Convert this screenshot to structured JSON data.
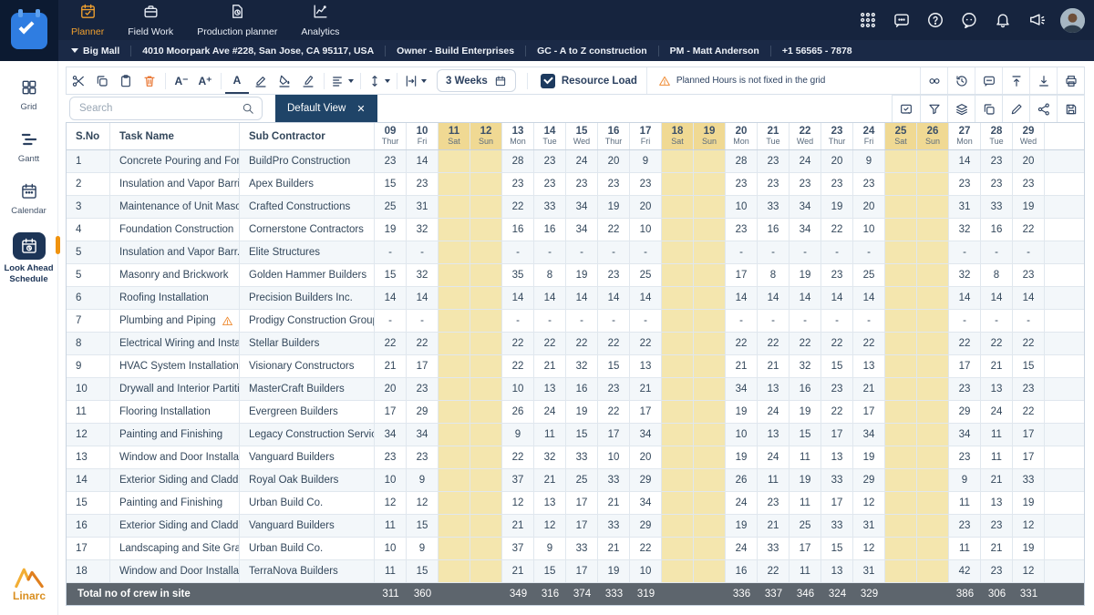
{
  "brand": {
    "name": "Linarc"
  },
  "topnav": {
    "tabs": [
      {
        "label": "Planner",
        "icon": "planner",
        "active": true
      },
      {
        "label": "Field Work",
        "icon": "fieldwork",
        "active": false
      },
      {
        "label": "Production planner",
        "icon": "production",
        "active": false
      },
      {
        "label": "Analytics",
        "icon": "analytics",
        "active": false
      }
    ],
    "right_icons": [
      "apps",
      "chat",
      "help",
      "bot",
      "bell",
      "megaphone"
    ]
  },
  "project_bar": {
    "segments": [
      "Big Mall",
      "4010 Moorpark Ave #228, San Jose, CA 95117, USA",
      "Owner - Build Enterprises",
      "GC - A to Z construction",
      "PM -  Matt Anderson",
      "+1 56565 - 7878"
    ]
  },
  "sidebar": {
    "items": [
      {
        "label": "Grid",
        "icon": "grid",
        "active": false
      },
      {
        "label": "Gantt",
        "icon": "gantt",
        "active": false
      },
      {
        "label": "Calendar",
        "icon": "calendar",
        "active": false
      },
      {
        "label": "Look Ahead Schedule",
        "icon": "lookahead",
        "active": true
      }
    ]
  },
  "toolbar": {
    "weeks_label": "3 Weeks",
    "resource_load_label": "Resource Load",
    "warning": "Planned Hours is not fixed in the grid"
  },
  "viewbar": {
    "search_placeholder": "Search",
    "view_tab": "Default View"
  },
  "table": {
    "columns": [
      "S.No",
      "Task Name",
      "Sub Contractor"
    ],
    "dates": [
      {
        "num": "09",
        "wd": "Thur"
      },
      {
        "num": "10",
        "wd": "Fri"
      },
      {
        "num": "11",
        "wd": "Sat"
      },
      {
        "num": "12",
        "wd": "Sun"
      },
      {
        "num": "13",
        "wd": "Mon"
      },
      {
        "num": "14",
        "wd": "Tue"
      },
      {
        "num": "15",
        "wd": "Wed"
      },
      {
        "num": "16",
        "wd": "Thur"
      },
      {
        "num": "17",
        "wd": "Fri"
      },
      {
        "num": "18",
        "wd": "Sat"
      },
      {
        "num": "19",
        "wd": "Sun"
      },
      {
        "num": "20",
        "wd": "Mon"
      },
      {
        "num": "21",
        "wd": "Tue"
      },
      {
        "num": "22",
        "wd": "Wed"
      },
      {
        "num": "23",
        "wd": "Thur"
      },
      {
        "num": "24",
        "wd": "Fri"
      },
      {
        "num": "25",
        "wd": "Sat"
      },
      {
        "num": "26",
        "wd": "Sun"
      },
      {
        "num": "27",
        "wd": "Mon"
      },
      {
        "num": "28",
        "wd": "Tue"
      },
      {
        "num": "29",
        "wd": "Wed"
      }
    ],
    "weekend_indices": [
      2,
      3,
      9,
      10,
      16,
      17
    ],
    "rows": [
      {
        "sno": "1",
        "task": "Concrete Pouring and Form...",
        "sub": "BuildPro Construction",
        "warn": false,
        "values": [
          "23",
          "14",
          "",
          "",
          "28",
          "23",
          "24",
          "20",
          "9",
          "",
          "",
          "28",
          "23",
          "24",
          "20",
          "9",
          "",
          "",
          "14",
          "23",
          "20"
        ]
      },
      {
        "sno": "2",
        "task": "Insulation and Vapor Barrier...",
        "sub": "Apex Builders",
        "warn": false,
        "values": [
          "15",
          "23",
          "",
          "",
          "23",
          "23",
          "23",
          "23",
          "23",
          "",
          "",
          "23",
          "23",
          "23",
          "23",
          "23",
          "",
          "",
          "23",
          "23",
          "23"
        ]
      },
      {
        "sno": "3",
        "task": "Maintenance of Unit Masor",
        "sub": "Crafted Constructions",
        "warn": false,
        "values": [
          "25",
          "31",
          "",
          "",
          "22",
          "33",
          "34",
          "19",
          "20",
          "",
          "",
          "10",
          "33",
          "34",
          "19",
          "20",
          "",
          "",
          "31",
          "33",
          "19"
        ]
      },
      {
        "sno": "4",
        "task": "Foundation Construction",
        "sub": "Cornerstone Contractors",
        "warn": false,
        "values": [
          "19",
          "32",
          "",
          "",
          "16",
          "16",
          "34",
          "22",
          "10",
          "",
          "",
          "23",
          "16",
          "34",
          "22",
          "10",
          "",
          "",
          "32",
          "16",
          "22"
        ]
      },
      {
        "sno": "5",
        "task": "Insulation and Vapor Barr...",
        "sub": "Elite Structures",
        "warn": true,
        "values": [
          "-",
          "-",
          "",
          "",
          "-",
          "-",
          "-",
          "-",
          "-",
          "",
          "",
          "-",
          "-",
          "-",
          "-",
          "-",
          "",
          "",
          "-",
          "-",
          "-"
        ]
      },
      {
        "sno": "5",
        "task": "Masonry and Brickwork",
        "sub": "Golden Hammer Builders",
        "warn": false,
        "values": [
          "15",
          "32",
          "",
          "",
          "35",
          "8",
          "19",
          "23",
          "25",
          "",
          "",
          "17",
          "8",
          "19",
          "23",
          "25",
          "",
          "",
          "32",
          "8",
          "23"
        ]
      },
      {
        "sno": "6",
        "task": "Roofing Installation",
        "sub": "Precision Builders Inc.",
        "warn": false,
        "values": [
          "14",
          "14",
          "",
          "",
          "14",
          "14",
          "14",
          "14",
          "14",
          "",
          "",
          "14",
          "14",
          "14",
          "14",
          "14",
          "",
          "",
          "14",
          "14",
          "14"
        ]
      },
      {
        "sno": "7",
        "task": "Plumbing and Piping",
        "sub": "Prodigy Construction Group",
        "warn": true,
        "values": [
          "-",
          "-",
          "",
          "",
          "-",
          "-",
          "-",
          "-",
          "-",
          "",
          "",
          "-",
          "-",
          "-",
          "-",
          "-",
          "",
          "",
          "-",
          "-",
          "-"
        ]
      },
      {
        "sno": "8",
        "task": "Electrical Wiring and Installa...",
        "sub": "Stellar Builders",
        "warn": false,
        "values": [
          "22",
          "22",
          "",
          "",
          "22",
          "22",
          "22",
          "22",
          "22",
          "",
          "",
          "22",
          "22",
          "22",
          "22",
          "22",
          "",
          "",
          "22",
          "22",
          "22"
        ]
      },
      {
        "sno": "9",
        "task": "HVAC System Installation",
        "sub": "Visionary Constructors",
        "warn": false,
        "values": [
          "21",
          "17",
          "",
          "",
          "22",
          "21",
          "32",
          "15",
          "13",
          "",
          "",
          "21",
          "21",
          "32",
          "15",
          "13",
          "",
          "",
          "17",
          "21",
          "15"
        ]
      },
      {
        "sno": "10",
        "task": "Drywall and Interior Partitio...",
        "sub": "MasterCraft Builders",
        "warn": false,
        "values": [
          "20",
          "23",
          "",
          "",
          "10",
          "13",
          "16",
          "23",
          "21",
          "",
          "",
          "34",
          "13",
          "16",
          "23",
          "21",
          "",
          "",
          "23",
          "13",
          "23"
        ]
      },
      {
        "sno": "11",
        "task": "Flooring Installation",
        "sub": "Evergreen Builders",
        "warn": false,
        "values": [
          "17",
          "29",
          "",
          "",
          "26",
          "24",
          "19",
          "22",
          "17",
          "",
          "",
          "19",
          "24",
          "19",
          "22",
          "17",
          "",
          "",
          "29",
          "24",
          "22"
        ]
      },
      {
        "sno": "12",
        "task": "Painting and Finishing",
        "sub": "Legacy Construction Services",
        "warn": false,
        "values": [
          "34",
          "34",
          "",
          "",
          "9",
          "11",
          "15",
          "17",
          "34",
          "",
          "",
          "10",
          "13",
          "15",
          "17",
          "34",
          "",
          "",
          "34",
          "11",
          "17"
        ]
      },
      {
        "sno": "13",
        "task": "Window and Door Installation",
        "sub": "Vanguard Builders",
        "warn": false,
        "values": [
          "23",
          "23",
          "",
          "",
          "22",
          "32",
          "33",
          "10",
          "20",
          "",
          "",
          "19",
          "24",
          "11",
          "13",
          "19",
          "",
          "",
          "23",
          "11",
          "17"
        ]
      },
      {
        "sno": "14",
        "task": "Exterior Siding and Cladding",
        "sub": "Royal Oak Builders",
        "warn": false,
        "values": [
          "10",
          "9",
          "",
          "",
          "37",
          "21",
          "25",
          "33",
          "29",
          "",
          "",
          "26",
          "11",
          "19",
          "33",
          "29",
          "",
          "",
          "9",
          "21",
          "33"
        ]
      },
      {
        "sno": "15",
        "task": "Painting and Finishing",
        "sub": "Urban Build Co.",
        "warn": false,
        "values": [
          "12",
          "12",
          "",
          "",
          "12",
          "13",
          "17",
          "21",
          "34",
          "",
          "",
          "24",
          "23",
          "11",
          "17",
          "12",
          "",
          "",
          "11",
          "13",
          "19"
        ]
      },
      {
        "sno": "16",
        "task": "Exterior Siding and Cladding",
        "sub": "Vanguard Builders",
        "warn": false,
        "values": [
          "11",
          "15",
          "",
          "",
          "21",
          "12",
          "17",
          "33",
          "29",
          "",
          "",
          "19",
          "21",
          "25",
          "33",
          "31",
          "",
          "",
          "23",
          "23",
          "12"
        ]
      },
      {
        "sno": "17",
        "task": "Landscaping and Site Grading",
        "sub": "Urban Build Co.",
        "warn": false,
        "values": [
          "10",
          "9",
          "",
          "",
          "37",
          "9",
          "33",
          "21",
          "22",
          "",
          "",
          "24",
          "33",
          "17",
          "15",
          "12",
          "",
          "",
          "11",
          "21",
          "19"
        ]
      },
      {
        "sno": "18",
        "task": "Window and Door Installation",
        "sub": "TerraNova Builders",
        "warn": false,
        "values": [
          "11",
          "15",
          "",
          "",
          "21",
          "15",
          "17",
          "19",
          "10",
          "",
          "",
          "16",
          "22",
          "11",
          "13",
          "31",
          "",
          "",
          "42",
          "23",
          "12"
        ]
      }
    ],
    "total_label": "Total no of crew in site",
    "totals": [
      "311",
      "360",
      "",
      "",
      "349",
      "316",
      "374",
      "333",
      "319",
      "",
      "",
      "336",
      "337",
      "346",
      "324",
      "329",
      "",
      "",
      "386",
      "306",
      "331"
    ]
  }
}
